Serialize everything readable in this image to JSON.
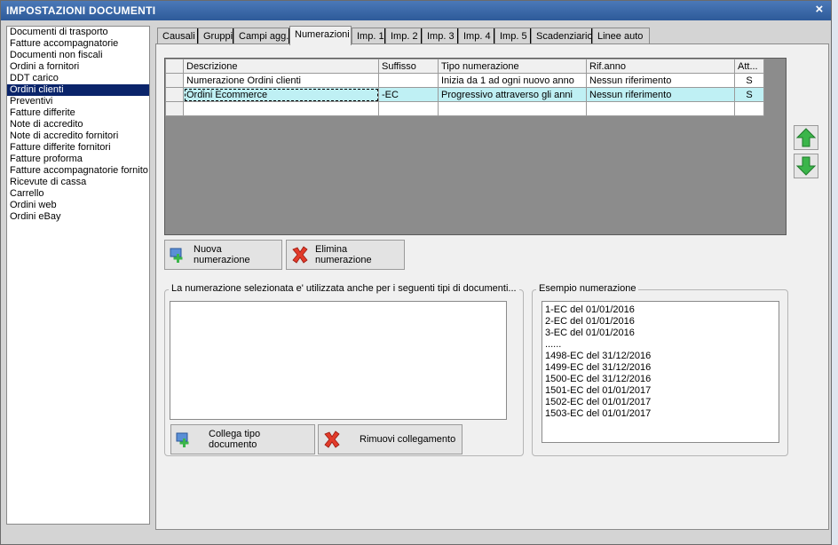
{
  "window": {
    "title": "IMPOSTAZIONI DOCUMENTI",
    "close_label": "×"
  },
  "doc_types": [
    "Documenti di trasporto",
    "Fatture accompagnatorie",
    "Documenti non fiscali",
    "Ordini a fornitori",
    "DDT carico",
    "Ordini clienti",
    "Preventivi",
    "Fatture differite",
    "Note di accredito",
    "Note di accredito fornitori",
    "Fatture differite fornitori",
    "Fatture proforma",
    "Fatture accompagnatorie fornito",
    "Ricevute di cassa",
    "Carrello",
    "Ordini web",
    "Ordini eBay"
  ],
  "selected_doc_type_index": 5,
  "tabs": [
    {
      "label": "Causali"
    },
    {
      "label": "Gruppi"
    },
    {
      "label": "Campi agg."
    },
    {
      "label": "Numerazioni"
    },
    {
      "label": "Imp. 1"
    },
    {
      "label": "Imp. 2"
    },
    {
      "label": "Imp. 3"
    },
    {
      "label": "Imp. 4"
    },
    {
      "label": "Imp. 5"
    },
    {
      "label": "Scadenziario"
    },
    {
      "label": "Linee auto"
    }
  ],
  "active_tab_index": 3,
  "numbering_grid": {
    "columns": [
      "Descrizione",
      "Suffisso",
      "Tipo numerazione",
      "Rif.anno",
      "Att..."
    ],
    "rows": [
      [
        "Numerazione Ordini clienti",
        "",
        "Inizia da 1 ad ogni nuovo anno",
        "Nessun riferimento",
        "S"
      ],
      [
        "Ordini Ecommerce",
        "-EC",
        "Progressivo attraverso gli anni",
        "Nessun riferimento",
        "S"
      ],
      [
        "",
        "",
        "",
        "",
        ""
      ]
    ],
    "selected_row_index": 1
  },
  "buttons": {
    "new_numbering": "Nuova numerazione",
    "delete_numbering": "Elimina numerazione",
    "link_doc_type": "Collega tipo documento",
    "remove_link": "Rimuovi collegamento"
  },
  "linked_docs_group": {
    "title": "La numerazione selezionata e' utilizzata anche per i seguenti tipi di documenti...",
    "items": []
  },
  "example_group": {
    "title": "Esempio numerazione",
    "lines": [
      "1-EC del 01/01/2016",
      "2-EC del 01/01/2016",
      "3-EC del 01/01/2016",
      "......",
      "1498-EC del 31/12/2016",
      "1499-EC del 31/12/2016",
      "1500-EC del 31/12/2016",
      "1501-EC del 01/01/2017",
      "1502-EC del 01/01/2017",
      "1503-EC del 01/01/2017"
    ]
  },
  "colors": {
    "title_bar": "#2d5a99",
    "selected_list_item": "#0a246a",
    "selected_grid_row": "#bff0f4",
    "grid_background": "#8c8c8c",
    "arrow_green": "#3bb54a"
  },
  "icons": {
    "up": "arrow-up-icon",
    "down": "arrow-down-icon",
    "add": "add-document-icon",
    "delete": "red-x-icon"
  }
}
